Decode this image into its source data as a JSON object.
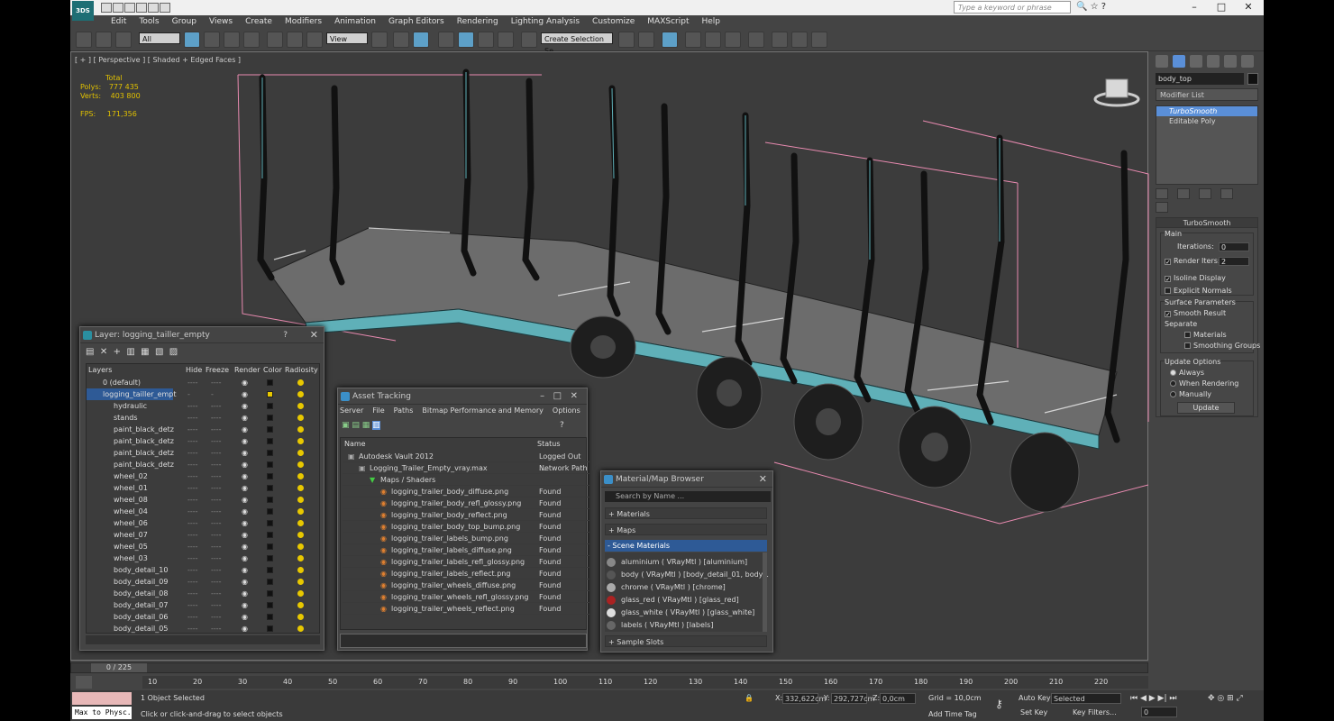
{
  "app": {
    "logo": "3DS",
    "search_placeholder": "Type a keyword or phrase",
    "window_buttons": [
      "–",
      "□",
      "✕"
    ]
  },
  "menu": [
    "Edit",
    "Tools",
    "Group",
    "Views",
    "Create",
    "Modifiers",
    "Animation",
    "Graph Editors",
    "Rendering",
    "Lighting Analysis",
    "Customize",
    "MAXScript",
    "Help"
  ],
  "toolbar": {
    "selection_filter": "All",
    "ref_coord": "View",
    "selection_set": "Create Selection Se"
  },
  "viewport": {
    "label": "[ + ] [ Perspective ] [ Shaded + Edged Faces ]",
    "stats": {
      "total_label": "Total",
      "polys_label": "Polys:",
      "polys": "777 435",
      "verts_label": "Verts:",
      "verts": "403 800",
      "fps_label": "FPS:",
      "fps": "171,356"
    }
  },
  "command_panel": {
    "object_name": "body_top",
    "modifier_list": "Modifier List",
    "stack": [
      "TurboSmooth",
      "Editable Poly"
    ],
    "rollout_title": "TurboSmooth",
    "main_label": "Main",
    "iterations_label": "Iterations:",
    "iterations": "0",
    "render_iters_label": "Render Iters:",
    "render_iters": "2",
    "isoline_label": "Isoline Display",
    "explicit_normals_label": "Explicit Normals",
    "surface_params_label": "Surface Parameters",
    "smooth_result_label": "Smooth Result",
    "separate_label": "Separate",
    "materials_label": "Materials",
    "smoothing_groups_label": "Smoothing Groups",
    "update_options_label": "Update Options",
    "always_label": "Always",
    "when_rendering_label": "When Rendering",
    "manually_label": "Manually",
    "update_button": "Update"
  },
  "layer_window": {
    "title": "Layer: logging_tailler_empty",
    "help": "?",
    "close": "✕",
    "columns": [
      "Layers",
      "Hide",
      "Freeze",
      "Render",
      "Color",
      "Radiosity"
    ],
    "rows": [
      {
        "name": "0 (default)",
        "level": 0,
        "color": "#111111"
      },
      {
        "name": "logging_tailler_empt",
        "level": 0,
        "color": "#e8c800",
        "selected": true
      },
      {
        "name": "hydraulic",
        "level": 1,
        "color": "#111111"
      },
      {
        "name": "stands",
        "level": 1,
        "color": "#111111"
      },
      {
        "name": "paint_black_detz",
        "level": 1,
        "color": "#111111"
      },
      {
        "name": "paint_black_detz",
        "level": 1,
        "color": "#111111"
      },
      {
        "name": "paint_black_detz",
        "level": 1,
        "color": "#111111"
      },
      {
        "name": "paint_black_detz",
        "level": 1,
        "color": "#111111"
      },
      {
        "name": "wheel_02",
        "level": 1,
        "color": "#111111"
      },
      {
        "name": "wheel_01",
        "level": 1,
        "color": "#111111"
      },
      {
        "name": "wheel_08",
        "level": 1,
        "color": "#111111"
      },
      {
        "name": "wheel_04",
        "level": 1,
        "color": "#111111"
      },
      {
        "name": "wheel_06",
        "level": 1,
        "color": "#111111"
      },
      {
        "name": "wheel_07",
        "level": 1,
        "color": "#111111"
      },
      {
        "name": "wheel_05",
        "level": 1,
        "color": "#111111"
      },
      {
        "name": "wheel_03",
        "level": 1,
        "color": "#111111"
      },
      {
        "name": "body_detail_10",
        "level": 1,
        "color": "#111111"
      },
      {
        "name": "body_detail_09",
        "level": 1,
        "color": "#111111"
      },
      {
        "name": "body_detail_08",
        "level": 1,
        "color": "#111111"
      },
      {
        "name": "body_detail_07",
        "level": 1,
        "color": "#111111"
      },
      {
        "name": "body_detail_06",
        "level": 1,
        "color": "#111111"
      },
      {
        "name": "body_detail_05",
        "level": 1,
        "color": "#111111"
      }
    ],
    "cell_dash": "----"
  },
  "asset_window": {
    "title": "Asset Tracking",
    "menu": [
      "Server",
      "File",
      "Paths",
      "Bitmap Performance and Memory",
      "Options"
    ],
    "columns": [
      "Name",
      "Status"
    ],
    "rows": [
      {
        "name": "Autodesk Vault 2012",
        "status": "Logged Out ...",
        "level": 0
      },
      {
        "name": "Logging_Trailer_Empty_vray.max",
        "status": "Network Path",
        "level": 1
      },
      {
        "name": "Maps / Shaders",
        "status": "",
        "level": 2
      },
      {
        "name": "logging_trailer_body_diffuse.png",
        "status": "Found",
        "level": 3
      },
      {
        "name": "logging_trailer_body_refl_glossy.png",
        "status": "Found",
        "level": 3
      },
      {
        "name": "logging_trailer_body_reflect.png",
        "status": "Found",
        "level": 3
      },
      {
        "name": "logging_trailer_body_top_bump.png",
        "status": "Found",
        "level": 3
      },
      {
        "name": "logging_trailer_labels_bump.png",
        "status": "Found",
        "level": 3
      },
      {
        "name": "logging_trailer_labels_diffuse.png",
        "status": "Found",
        "level": 3
      },
      {
        "name": "logging_trailer_labels_refl_glossy.png",
        "status": "Found",
        "level": 3
      },
      {
        "name": "logging_trailer_labels_reflect.png",
        "status": "Found",
        "level": 3
      },
      {
        "name": "logging_trailer_wheels_diffuse.png",
        "status": "Found",
        "level": 3
      },
      {
        "name": "logging_trailer_wheels_refl_glossy.png",
        "status": "Found",
        "level": 3
      },
      {
        "name": "logging_trailer_wheels_reflect.png",
        "status": "Found",
        "level": 3
      }
    ]
  },
  "material_window": {
    "title": "Material/Map Browser",
    "search_placeholder": "Search by Name ...",
    "sections": [
      "+ Materials",
      "+ Maps",
      "- Scene Materials"
    ],
    "items": [
      {
        "label": "aluminium  ( VRayMtl ) [aluminium]",
        "color": "#888888"
      },
      {
        "label": "body  ( VRayMtl ) [body_detail_01, body...",
        "color": "#555555"
      },
      {
        "label": "chrome  ( VRayMtl ) [chrome]",
        "color": "#aaaaaa"
      },
      {
        "label": "glass_red  ( VRayMtl ) [glass_red]",
        "color": "#aa2222"
      },
      {
        "label": "glass_white  ( VRayMtl ) [glass_white]",
        "color": "#dddddd"
      },
      {
        "label": "labels  ( VRayMtl ) [labels]",
        "color": "#666666"
      }
    ],
    "sample_slots": "+ Sample Slots"
  },
  "timeline": {
    "frame_counter": "0 / 225",
    "ticks": [
      "10",
      "20",
      "30",
      "40",
      "50",
      "60",
      "70",
      "80",
      "90",
      "100",
      "110",
      "120",
      "130",
      "140",
      "150",
      "160",
      "170",
      "180",
      "190",
      "200",
      "210",
      "220"
    ]
  },
  "status_bar": {
    "maxscript": "Max to Physc.",
    "selection": "1 Object Selected",
    "prompt": "Click or click-and-drag to select objects",
    "x_label": "X:",
    "x": "332,622cm",
    "y_label": "Y:",
    "y": "292,727cm",
    "z_label": "Z:",
    "z": "0,0cm",
    "grid": "Grid = 10,0cm",
    "add_time_tag": "Add Time Tag",
    "auto_key": "Auto Key",
    "set_key": "Set Key",
    "selected": "Selected",
    "key_filters": "Key Filters...",
    "frame": "0"
  },
  "colors": {
    "accent": "#5a8fd8",
    "trailer": "#5fb0b8",
    "bbox": "#e88ab0",
    "stats": "#e0c000"
  }
}
